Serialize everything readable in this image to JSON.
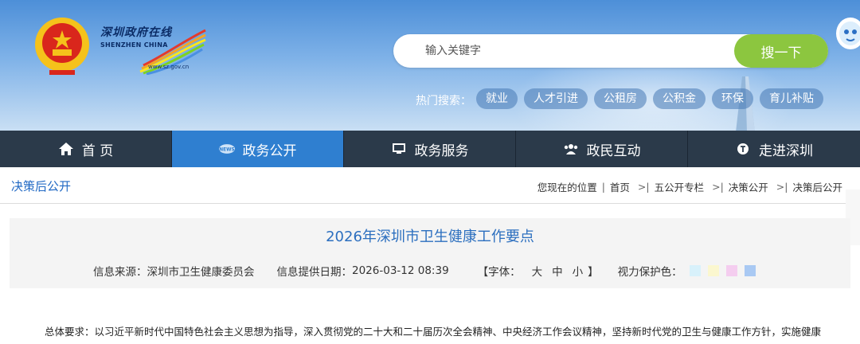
{
  "header": {
    "logo_cn": "深圳政府在线",
    "logo_en": "SHENZHEN CHINA",
    "logo_url": "www.sz.gov.cn",
    "search": {
      "placeholder": "输入关键字",
      "button_label": "搜一下"
    },
    "hot_search": {
      "label": "热门搜索：",
      "tags": [
        "就业",
        "人才引进",
        "公租房",
        "公积金",
        "环保",
        "育儿补贴"
      ]
    }
  },
  "nav": {
    "items": [
      {
        "label": "首 页",
        "icon": "home-icon"
      },
      {
        "label": "政务公开",
        "icon": "news-icon"
      },
      {
        "label": "政务服务",
        "icon": "monitor-icon"
      },
      {
        "label": "政民互动",
        "icon": "people-icon"
      },
      {
        "label": "走进深圳",
        "icon": "globe-icon"
      }
    ],
    "active_index": 1
  },
  "breadcrumb": {
    "section_title": "决策后公开",
    "prefix": "您现在的位置",
    "items": [
      "首页",
      "五公开专栏",
      "决策公开",
      "决策后公开"
    ]
  },
  "article": {
    "title": "2026年深圳市卫生健康工作要点",
    "source_label": "信息来源：",
    "source_value": "深圳市卫生健康委员会",
    "date_label": "信息提供日期：",
    "date_value": "2026-03-12 08:39",
    "font_label": "【字体：",
    "font_sizes": [
      "大",
      "中",
      "小"
    ],
    "font_close": "】",
    "eye_label": "视力保护色：",
    "eye_colors": [
      "#d8f1fb",
      "#fbf7cf",
      "#f4cdef",
      "#a9c9f3"
    ],
    "body_first_line": "总体要求：以习近平新时代中国特色社会主义思想为指导，深入贯彻党的二十大和二十届历次全会精神、中央经济工作会议精神，坚持新时代党的卫生与健康工作方针，实施健康"
  },
  "colors": {
    "nav_bg": "#2b3a4a",
    "nav_active": "#2f7fd0",
    "search_button": "#8cc63f",
    "title_blue": "#2c6fbf"
  }
}
